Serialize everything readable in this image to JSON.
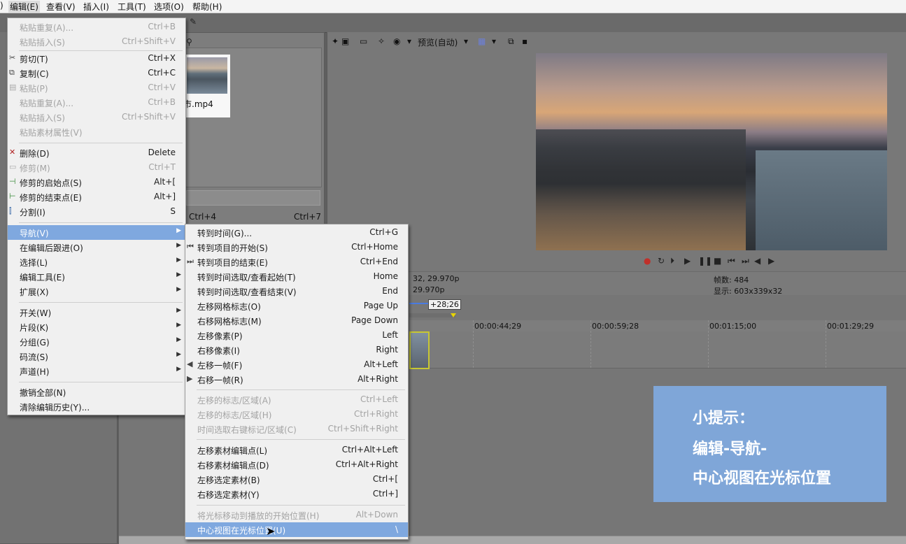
{
  "menubar": {
    "items": [
      {
        "label": ")"
      },
      {
        "label": "编辑(E)"
      },
      {
        "label": "查看(V)"
      },
      {
        "label": "插入(I)"
      },
      {
        "label": "工具(T)"
      },
      {
        "label": "选项(O)"
      },
      {
        "label": "帮助(H)"
      }
    ]
  },
  "explorer": {
    "thumbnail_name": "市.mp4",
    "shortcut_left": "Ctrl+4",
    "shortcut_right": "Ctrl+7"
  },
  "preview": {
    "toolbar_label": "预览(自动)",
    "info": {
      "left_line1": "32, 29.970p",
      "left_line2": "29.970p",
      "frames": "帧数: 484",
      "display": "显示: 603x339x32"
    }
  },
  "timeline": {
    "cursor_tag": "+28;26",
    "ticks": [
      "00:00:44;29",
      "00:00:59;28",
      "00:01:15;00",
      "00:01:29;29"
    ]
  },
  "edit_menu": {
    "items": [
      {
        "label": "粘贴重复(A)...",
        "shortcut": "Ctrl+B",
        "disabled": true
      },
      {
        "label": "粘贴插入(S)",
        "shortcut": "Ctrl+Shift+V",
        "disabled": true
      },
      {
        "label": "剪切(T)",
        "shortcut": "Ctrl+X",
        "disabled": false,
        "icon": "scissors-icon"
      },
      {
        "label": "复制(C)",
        "shortcut": "Ctrl+C",
        "disabled": false,
        "icon": "copy-icon"
      },
      {
        "label": "粘贴(P)",
        "shortcut": "Ctrl+V",
        "disabled": true,
        "icon": "paste-icon"
      },
      {
        "label": "粘贴重复(A)...",
        "shortcut": "Ctrl+B",
        "disabled": true
      },
      {
        "label": "粘贴插入(S)",
        "shortcut": "Ctrl+Shift+V",
        "disabled": true
      },
      {
        "label": "粘贴素材属性(V)",
        "shortcut": "",
        "disabled": true
      },
      {
        "label": "删除(D)",
        "shortcut": "Delete",
        "disabled": false,
        "icon": "delete-icon"
      },
      {
        "label": "修剪(M)",
        "shortcut": "Ctrl+T",
        "disabled": true,
        "icon": "trim-icon"
      },
      {
        "label": "修剪的启始点(S)",
        "shortcut": "Alt+[",
        "disabled": false,
        "icon": "trim-start-icon"
      },
      {
        "label": "修剪的结束点(E)",
        "shortcut": "Alt+]",
        "disabled": false,
        "icon": "trim-end-icon"
      },
      {
        "label": "分割(I)",
        "shortcut": "S",
        "disabled": false,
        "icon": "split-icon"
      },
      {
        "label": "导航(V)",
        "shortcut": "",
        "disabled": false,
        "submenu": true,
        "highlighted": true
      },
      {
        "label": "在编辑后跟进(O)",
        "shortcut": "",
        "disabled": false,
        "submenu": true
      },
      {
        "label": "选择(L)",
        "shortcut": "",
        "disabled": false,
        "submenu": true
      },
      {
        "label": "编辑工具(E)",
        "shortcut": "",
        "disabled": false,
        "submenu": true
      },
      {
        "label": "扩展(X)",
        "shortcut": "",
        "disabled": false,
        "submenu": true
      },
      {
        "label": "开关(W)",
        "shortcut": "",
        "disabled": false,
        "submenu": true
      },
      {
        "label": "片段(K)",
        "shortcut": "",
        "disabled": false,
        "submenu": true
      },
      {
        "label": "分组(G)",
        "shortcut": "",
        "disabled": false,
        "submenu": true
      },
      {
        "label": "码流(S)",
        "shortcut": "",
        "disabled": false,
        "submenu": true
      },
      {
        "label": "声道(H)",
        "shortcut": "",
        "disabled": false,
        "submenu": true
      },
      {
        "label": "撤销全部(N)",
        "shortcut": "",
        "disabled": false
      },
      {
        "label": "清除编辑历史(Y)...",
        "shortcut": "",
        "disabled": false
      }
    ]
  },
  "nav_menu": {
    "items": [
      {
        "label": "转到时间(G)...",
        "shortcut": "Ctrl+G",
        "disabled": false
      },
      {
        "label": "转到项目的开始(S)",
        "shortcut": "Ctrl+Home",
        "disabled": false,
        "icon": "go-start-icon"
      },
      {
        "label": "转到项目的结束(E)",
        "shortcut": "Ctrl+End",
        "disabled": false,
        "icon": "go-end-icon"
      },
      {
        "label": "转到时间选取/查看起始(T)",
        "shortcut": "Home",
        "disabled": false
      },
      {
        "label": "转到时间选取/查看结束(V)",
        "shortcut": "End",
        "disabled": false
      },
      {
        "label": "左移网格标志(O)",
        "shortcut": "Page Up",
        "disabled": false
      },
      {
        "label": "右移网格标志(M)",
        "shortcut": "Page Down",
        "disabled": false
      },
      {
        "label": "左移像素(P)",
        "shortcut": "Left",
        "disabled": false
      },
      {
        "label": "右移像素(I)",
        "shortcut": "Right",
        "disabled": false
      },
      {
        "label": "左移一帧(F)",
        "shortcut": "Alt+Left",
        "disabled": false,
        "icon": "prev-frame-icon"
      },
      {
        "label": "右移一帧(R)",
        "shortcut": "Alt+Right",
        "disabled": false,
        "icon": "next-frame-icon"
      },
      {
        "label": "左移的标志/区域(A)",
        "shortcut": "Ctrl+Left",
        "disabled": true
      },
      {
        "label": "左移的标志/区域(H)",
        "shortcut": "Ctrl+Right",
        "disabled": true
      },
      {
        "label": "时间选取右键标记/区域(C)",
        "shortcut": "Ctrl+Shift+Right",
        "disabled": true
      },
      {
        "label": "左移素材编辑点(L)",
        "shortcut": "Ctrl+Alt+Left",
        "disabled": false
      },
      {
        "label": "右移素材编辑点(D)",
        "shortcut": "Ctrl+Alt+Right",
        "disabled": false
      },
      {
        "label": "左移选定素材(B)",
        "shortcut": "Ctrl+[",
        "disabled": false
      },
      {
        "label": "右移选定素材(Y)",
        "shortcut": "Ctrl+]",
        "disabled": false
      },
      {
        "label": "将光标移动到播放的开始位置(H)",
        "shortcut": "Alt+Down",
        "disabled": true
      },
      {
        "label": "中心视图在光标位置(U)",
        "shortcut": "\\",
        "disabled": false,
        "highlighted": true
      }
    ]
  },
  "hint": {
    "line1": "小提示：",
    "line2": "编辑-导航-",
    "line3": "中心视图在光标位置"
  },
  "colors": {
    "menu_highlight": "#7fa8df",
    "hint_bg": "#7fa6d8",
    "clip_border": "#c7c733"
  }
}
